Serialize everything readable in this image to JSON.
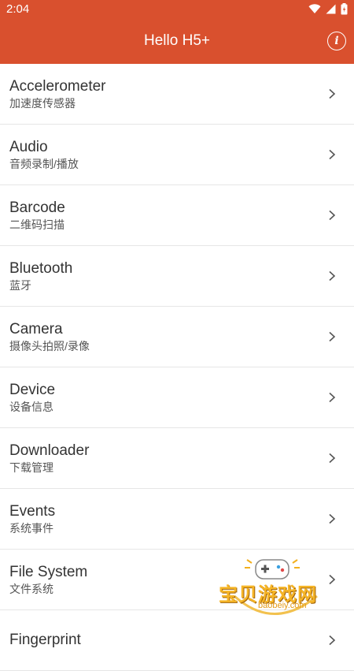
{
  "status": {
    "time": "2:04"
  },
  "header": {
    "title": "Hello H5+",
    "info_icon": "info-icon"
  },
  "items": [
    {
      "title": "Accelerometer",
      "subtitle": "加速度传感器"
    },
    {
      "title": "Audio",
      "subtitle": "音频录制/播放"
    },
    {
      "title": "Barcode",
      "subtitle": "二维码扫描"
    },
    {
      "title": "Bluetooth",
      "subtitle": "蓝牙"
    },
    {
      "title": "Camera",
      "subtitle": "摄像头拍照/录像"
    },
    {
      "title": "Device",
      "subtitle": "设备信息"
    },
    {
      "title": "Downloader",
      "subtitle": "下载管理"
    },
    {
      "title": "Events",
      "subtitle": "系统事件"
    },
    {
      "title": "File System",
      "subtitle": "文件系统"
    },
    {
      "title": "Fingerprint",
      "subtitle": ""
    }
  ],
  "watermark": {
    "name": "宝贝游戏网",
    "domain": "baobeiy.com"
  },
  "colors": {
    "accent": "#d9502e"
  }
}
